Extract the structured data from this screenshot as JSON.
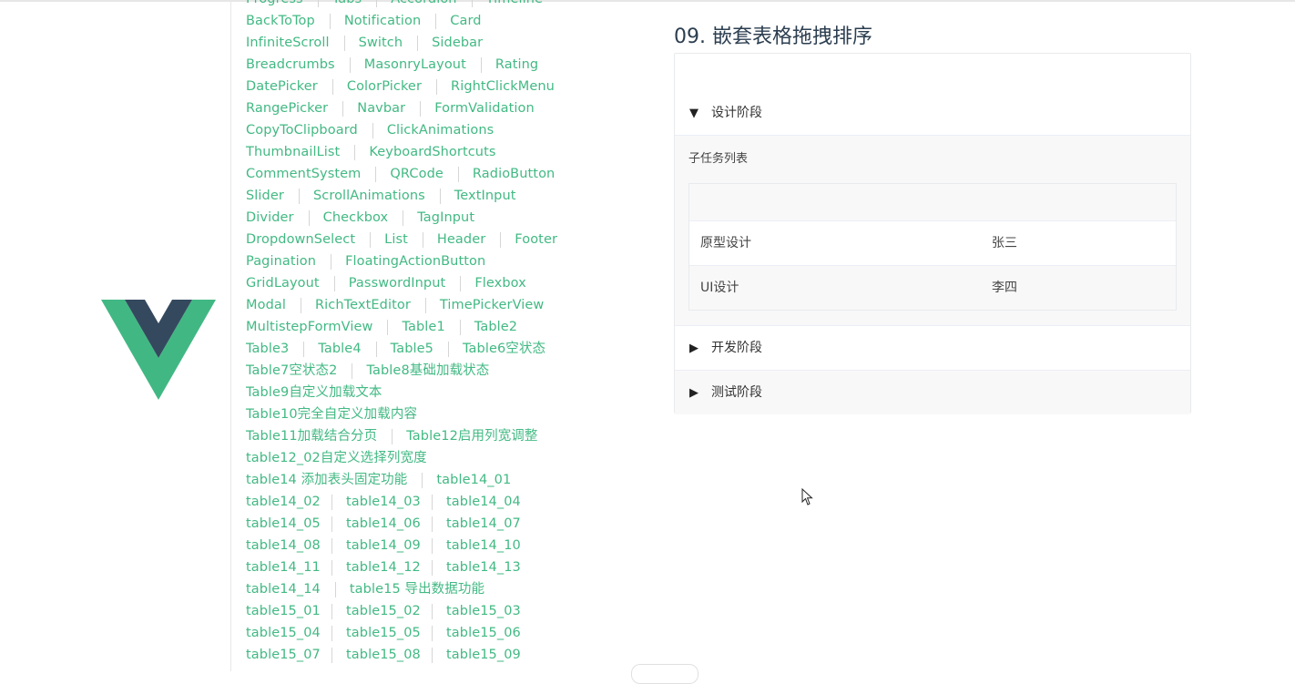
{
  "nav": {
    "rows": [
      [
        "Progress",
        "Tabs",
        "Accordion",
        "Timeline"
      ],
      [
        "BackToTop",
        "Notification",
        "Card"
      ],
      [
        "InfiniteScroll",
        "Switch",
        "Sidebar"
      ],
      [
        "Breadcrumbs",
        "MasonryLayout",
        "Rating"
      ],
      [
        "DatePicker",
        "ColorPicker",
        "RightClickMenu"
      ],
      [
        "RangePicker",
        "Navbar",
        "FormValidation"
      ],
      [
        "CopyToClipboard",
        "ClickAnimations"
      ],
      [
        "ThumbnailList",
        "KeyboardShortcuts"
      ],
      [
        "CommentSystem",
        "QRCode",
        "RadioButton"
      ],
      [
        "Slider",
        "ScrollAnimations",
        "TextInput"
      ],
      [
        "Divider",
        "Checkbox",
        "TagInput"
      ],
      [
        "DropdownSelect",
        "List",
        "Header",
        "Footer"
      ],
      [
        "Pagination",
        "FloatingActionButton"
      ],
      [
        "GridLayout",
        "PasswordInput",
        "Flexbox"
      ],
      [
        "Modal",
        "RichTextEditor",
        "TimePickerView"
      ],
      [
        "MultistepFormView",
        "Table1",
        "Table2"
      ],
      [
        "Table3",
        "Table4",
        "Table5",
        "Table6空状态"
      ],
      [
        "Table7空状态2",
        "Table8基础加载状态"
      ],
      [
        "Table9自定义加载文本"
      ],
      [
        "Table10完全自定义加载内容"
      ],
      [
        "Table11加载结合分页",
        "Table12启用列宽调整"
      ],
      [
        "table12_02自定义选择列宽度"
      ],
      [
        "table14 添加表头固定功能",
        "table14_01"
      ],
      [
        "table14_02",
        "table14_03",
        "table14_04"
      ],
      [
        "table14_05",
        "table14_06",
        "table14_07"
      ],
      [
        "table14_08",
        "table14_09",
        "table14_10"
      ],
      [
        "table14_11",
        "table14_12",
        "table14_13"
      ],
      [
        "table14_14",
        "table15 导出数据功能"
      ],
      [
        "table15_01",
        "table15_02",
        "table15_03"
      ],
      [
        "table15_04",
        "table15_05",
        "table15_06"
      ],
      [
        "table15_07",
        "table15_08",
        "table15_09"
      ]
    ]
  },
  "demo": {
    "title": "09. 嵌套表格拖拽排序",
    "stages": [
      {
        "name": "设计阶段",
        "expanded": true,
        "caret": "▼"
      },
      {
        "name": "开发阶段",
        "expanded": false,
        "caret": "▶"
      },
      {
        "name": "测试阶段",
        "expanded": false,
        "caret": "▶"
      }
    ],
    "subtasks_title": "子任务列表",
    "subtasks": [
      {
        "task": "原型设计",
        "owner": "张三"
      },
      {
        "task": "UI设计",
        "owner": "李四"
      }
    ]
  },
  "colors": {
    "accent": "#42b983",
    "logo_green": "#41b883",
    "logo_dark": "#34495e",
    "text": "#2c3e50"
  },
  "icons": {
    "logo": "vue-logo",
    "cursor": "mouse-pointer-icon"
  }
}
